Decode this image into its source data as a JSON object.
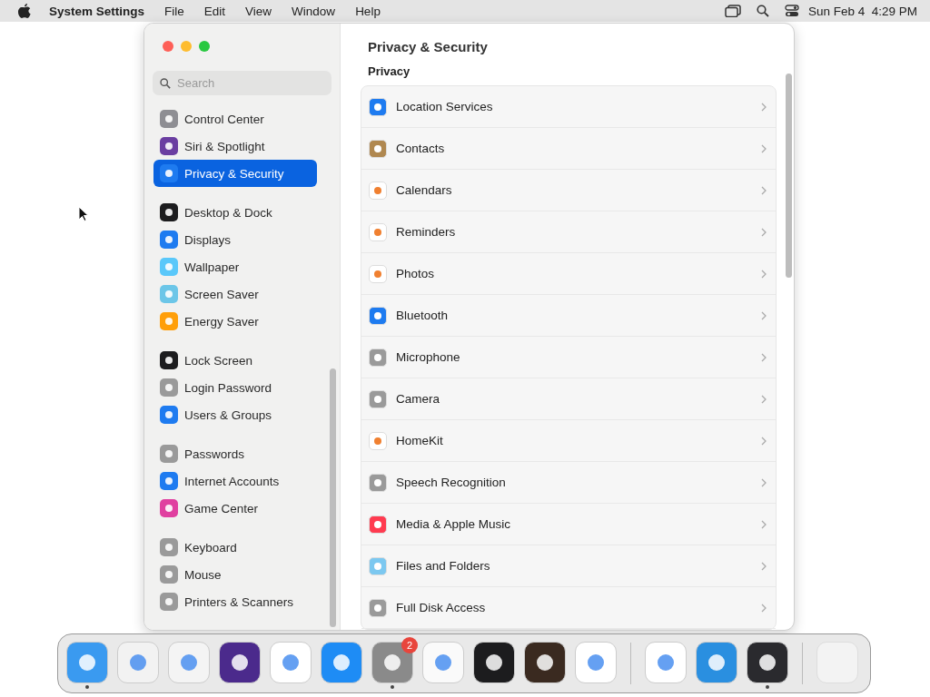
{
  "menu_bar": {
    "app_name": "System Settings",
    "menus": [
      "File",
      "Edit",
      "View",
      "Window",
      "Help"
    ],
    "clock": "Sun Feb 4  4:29 PM"
  },
  "sidebar": {
    "search": {
      "placeholder": "Search"
    },
    "groups": [
      [
        {
          "label": "Control Center",
          "selected": false
        },
        {
          "label": "Siri & Spotlight",
          "selected": false
        },
        {
          "label": "Privacy & Security",
          "selected": true
        }
      ],
      [
        {
          "label": "Desktop & Dock",
          "selected": false
        },
        {
          "label": "Displays",
          "selected": false
        },
        {
          "label": "Wallpaper",
          "selected": false
        },
        {
          "label": "Screen Saver",
          "selected": false
        },
        {
          "label": "Energy Saver",
          "selected": false
        }
      ],
      [
        {
          "label": "Lock Screen",
          "selected": false
        },
        {
          "label": "Login Password",
          "selected": false
        },
        {
          "label": "Users & Groups",
          "selected": false
        }
      ],
      [
        {
          "label": "Passwords",
          "selected": false
        },
        {
          "label": "Internet Accounts",
          "selected": false
        },
        {
          "label": "Game Center",
          "selected": false
        }
      ],
      [
        {
          "label": "Keyboard",
          "selected": false
        },
        {
          "label": "Mouse",
          "selected": false
        },
        {
          "label": "Printers & Scanners",
          "selected": false
        }
      ]
    ]
  },
  "content": {
    "title": "Privacy & Security",
    "section": "Privacy",
    "rows": [
      {
        "label": "Location Services"
      },
      {
        "label": "Contacts"
      },
      {
        "label": "Calendars"
      },
      {
        "label": "Reminders"
      },
      {
        "label": "Photos"
      },
      {
        "label": "Bluetooth"
      },
      {
        "label": "Microphone"
      },
      {
        "label": "Camera"
      },
      {
        "label": "HomeKit"
      },
      {
        "label": "Speech Recognition"
      },
      {
        "label": "Media & Apple Music"
      },
      {
        "label": "Files and Folders"
      },
      {
        "label": "Full Disk Access"
      }
    ]
  },
  "dock": {
    "apps": [
      {
        "running": true
      },
      {
        "running": false
      },
      {
        "running": false
      },
      {
        "running": false
      },
      {
        "running": false
      },
      {
        "running": false
      },
      {
        "running": true,
        "badge": "2"
      },
      {
        "running": false
      },
      {
        "running": false
      },
      {
        "running": false
      },
      {
        "running": false
      },
      {
        "running": false
      },
      {
        "running": false
      },
      {
        "running": true
      }
    ]
  }
}
